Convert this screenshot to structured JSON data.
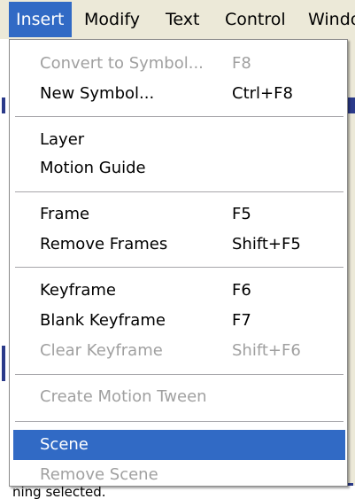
{
  "menubar": {
    "items": [
      {
        "label": "Insert"
      },
      {
        "label": "Modify"
      },
      {
        "label": "Text"
      },
      {
        "label": "Control"
      },
      {
        "label": "Windo"
      }
    ]
  },
  "menu": {
    "items": [
      {
        "label": "Convert to Symbol...",
        "shortcut": "F8",
        "disabled": true
      },
      {
        "label": "New Symbol...",
        "shortcut": "Ctrl+F8",
        "disabled": false
      },
      {
        "label": "Layer",
        "shortcut": "",
        "disabled": false
      },
      {
        "label": "Motion Guide",
        "shortcut": "",
        "disabled": false
      },
      {
        "label": "Frame",
        "shortcut": "F5",
        "disabled": false
      },
      {
        "label": "Remove Frames",
        "shortcut": "Shift+F5",
        "disabled": false
      },
      {
        "label": "Keyframe",
        "shortcut": "F6",
        "disabled": false
      },
      {
        "label": "Blank Keyframe",
        "shortcut": "F7",
        "disabled": false
      },
      {
        "label": "Clear Keyframe",
        "shortcut": "Shift+F6",
        "disabled": true
      },
      {
        "label": "Create Motion Tween",
        "shortcut": "",
        "disabled": true
      },
      {
        "label": "Scene",
        "shortcut": "",
        "disabled": false,
        "highlighted": true
      },
      {
        "label": "Remove Scene",
        "shortcut": "",
        "disabled": true
      }
    ]
  },
  "status": {
    "text": "ning selected."
  },
  "colors": {
    "highlight": "#316ac5",
    "disabled_text": "#a0a0a0",
    "menubar_bg": "#ece9d8"
  }
}
